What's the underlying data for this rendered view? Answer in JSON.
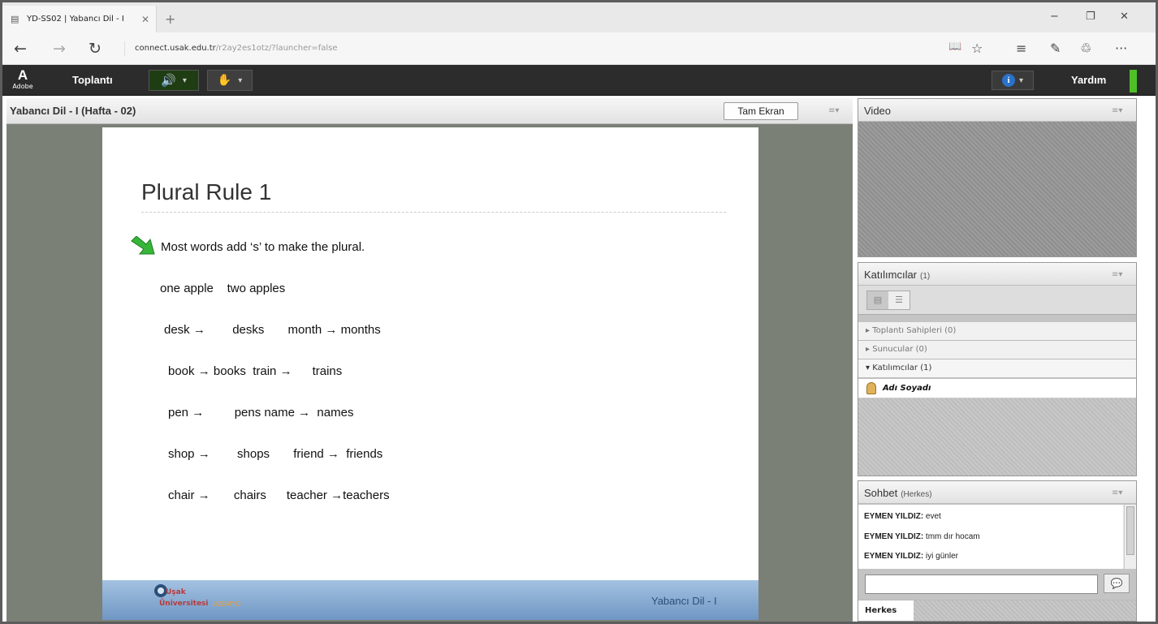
{
  "browser": {
    "tab_title": "YD-SS02 | Yabancı Dil - I",
    "tab_close": "✕",
    "new_tab": "+",
    "url_domain": "connect.usak.edu.tr",
    "url_path": "/r2ay2es1otz/?launcher=false",
    "window_minimize": "−",
    "window_restore": "❐",
    "window_close": "✕",
    "nav_back": "←",
    "nav_forward": "→",
    "nav_refresh": "↻",
    "tool_reading": "📖",
    "tool_favorite": "☆",
    "tool_hub": "≡",
    "tool_note": "✎",
    "tool_share": "♲",
    "tool_more": "···"
  },
  "connect": {
    "logo_letter": "A",
    "logo_text": "Adobe",
    "meeting_menu": "Toplantı",
    "speaker_icon": "🔊",
    "user_icon": "✋",
    "dropdown": "▾",
    "info_icon": "i",
    "help_menu": "Yardım"
  },
  "share_pod": {
    "title": "Yabancı Dil - I (Hafta - 02)",
    "fullscreen_button": "Tam Ekran",
    "menu_icon": "≡▾"
  },
  "slide": {
    "title": "Plural Rule 1",
    "bullet": "Most words add ‘s’ to make the plural.",
    "lines": [
      "one apple    two apples",
      "desk →        desks       month → months",
      "book → books  train →      trains",
      "pen →         pens name →  names",
      "shop →        shops       friend →  friends",
      "chair →       chairs      teacher →teachers"
    ],
    "footer_logo_top": "Uşak",
    "footer_logo_bottom": "Üniversitesi",
    "footer_logo_sub": "UZEMYO",
    "footer_text": "Yabancı Dil - I"
  },
  "video_pod": {
    "title": "Video",
    "menu_icon": "≡▾"
  },
  "attendees_pod": {
    "title": "Katılımcılar",
    "count": "(1)",
    "menu_icon": "≡▾",
    "groups": [
      {
        "label": "Toplantı Sahipleri (0)",
        "arrow": "▸"
      },
      {
        "label": "Sunucular (0)",
        "arrow": "▸"
      },
      {
        "label": "Katılımcılar (1)",
        "arrow": "▾"
      }
    ],
    "participant": "Adı Soyadı"
  },
  "chat_pod": {
    "title": "Sohbet",
    "scope": "(Herkes)",
    "menu_icon": "≡▾",
    "messages": [
      {
        "author": "EYMEN YILDIZ:",
        "text": " evet"
      },
      {
        "author": "EYMEN YILDIZ:",
        "text": " tmm dır hocam"
      },
      {
        "author": "EYMEN YILDIZ:",
        "text": " iyi günler"
      }
    ],
    "input_placeholder": "",
    "send_icon": "💬",
    "tab_label": "Herkes"
  },
  "colors": {
    "toolbar_bg": "#2c2c2c",
    "accent_green": "#4fbf27",
    "slide_footer": "#8fb0d6"
  }
}
